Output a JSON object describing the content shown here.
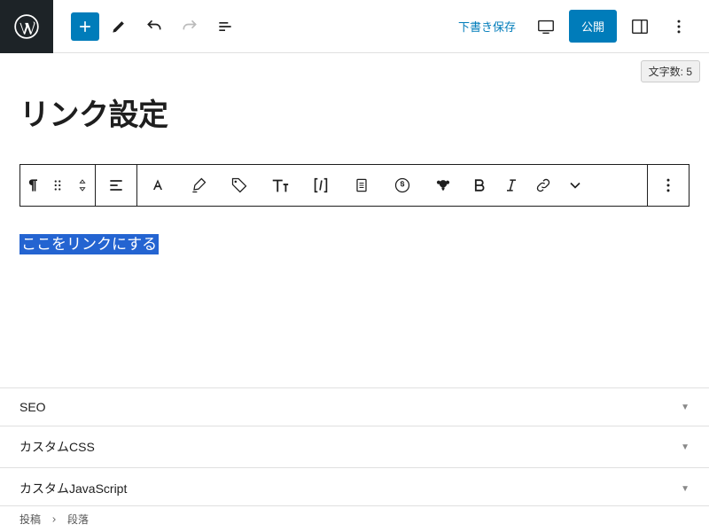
{
  "topbar": {
    "draft_save": "下書き保存",
    "publish": "公開"
  },
  "word_count": {
    "label": "文字数:",
    "value": "5"
  },
  "post": {
    "title": "リンク設定",
    "selected_text": "ここをリンクにする"
  },
  "panels": [
    {
      "label": "SEO"
    },
    {
      "label": "カスタムCSS"
    },
    {
      "label": "カスタムJavaScript"
    }
  ],
  "breadcrumb": {
    "root": "投稿",
    "leaf": "段落"
  }
}
